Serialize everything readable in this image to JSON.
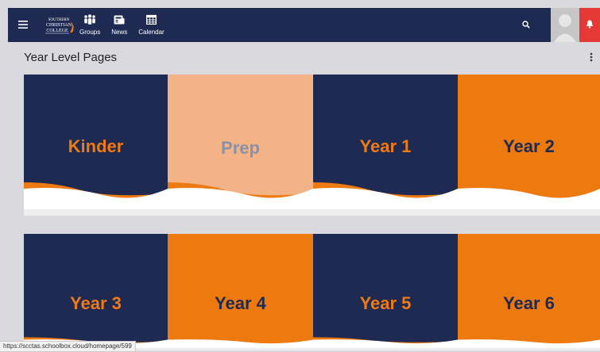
{
  "topbar": {
    "logo_name": "Southern Christian College",
    "nav": [
      {
        "label": "Groups",
        "icon": "groups-icon"
      },
      {
        "label": "News",
        "icon": "news-icon"
      },
      {
        "label": "Calendar",
        "icon": "calendar-icon"
      }
    ]
  },
  "page": {
    "title": "Year Level Pages"
  },
  "tiles": [
    {
      "label": "Kinder",
      "bg": "#1f2a52",
      "text": "#ee7a12"
    },
    {
      "label": "Prep",
      "bg": "#f4b386",
      "text": "#8a92a8"
    },
    {
      "label": "Year 1",
      "bg": "#1f2a52",
      "text": "#ee7a12"
    },
    {
      "label": "Year 2",
      "bg": "#ec7a0e",
      "text": "#1f2a52"
    },
    {
      "label": "Year 3",
      "bg": "#1f2a52",
      "text": "#ee7a12"
    },
    {
      "label": "Year 4",
      "bg": "#ec7a0e",
      "text": "#1f2a52"
    },
    {
      "label": "Year 5",
      "bg": "#1f2a52",
      "text": "#ee7a12"
    },
    {
      "label": "Year 6",
      "bg": "#ec7a0e",
      "text": "#1f2a52"
    }
  ],
  "status_bar": {
    "url": "https://scctas.schoolbox.cloud/homepage/599"
  }
}
